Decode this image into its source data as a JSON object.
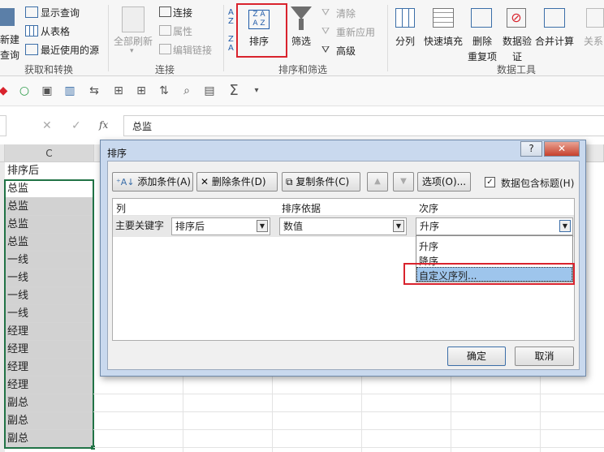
{
  "ribbon": {
    "left_group": {
      "new_query_line1": "新建",
      "new_query_line2": "查询",
      "show_query": "显示查询",
      "from_table": "从表格",
      "recent_sources": "最近使用的源",
      "label": "获取和转换"
    },
    "connections": {
      "refresh_all": "全部刷新",
      "connections": "连接",
      "properties": "属性",
      "edit_links": "编辑链接",
      "label": "连接"
    },
    "sort_filter": {
      "sort": "排序",
      "filter": "筛选",
      "clear": "清除",
      "reapply": "重新应用",
      "advanced": "高级",
      "label": "排序和筛选"
    },
    "data_tools": {
      "text_to_columns": "分列",
      "flash_fill": "快速填充",
      "remove_dup_line1": "删除",
      "remove_dup_line2": "重复项",
      "validation_line1": "数据验",
      "validation_line2": "证",
      "consolidate": "合并计算",
      "relationships": "关系",
      "label": "数据工具"
    }
  },
  "formula_bar": {
    "fx": "fx",
    "value": "总监"
  },
  "sheet": {
    "column_header": "C",
    "cells": [
      "排序后",
      "总监",
      "总监",
      "总监",
      "总监",
      "一线",
      "一线",
      "一线",
      "一线",
      "经理",
      "经理",
      "经理",
      "经理",
      "副总",
      "副总",
      "副总"
    ]
  },
  "dialog": {
    "title": "排序",
    "help": "?",
    "close": "✕",
    "add_level": "添加条件(A)",
    "delete_level": "删除条件(D)",
    "copy_level": "复制条件(C)",
    "options": "选项(O)...",
    "has_headers": "数据包含标题(H)",
    "col_header": "列",
    "sort_on_header": "排序依据",
    "order_header": "次序",
    "row_label": "主要关键字",
    "column_value": "排序后",
    "sort_on_value": "数值",
    "order_value": "升序",
    "options_list": [
      "升序",
      "降序",
      "自定义序列..."
    ],
    "ok": "确定",
    "cancel": "取消"
  },
  "colors": {
    "highlight": "#d9232d",
    "selected_option": "#9ec5ec",
    "sheet_selection": "#d2d2d2",
    "active_border": "#217346"
  }
}
